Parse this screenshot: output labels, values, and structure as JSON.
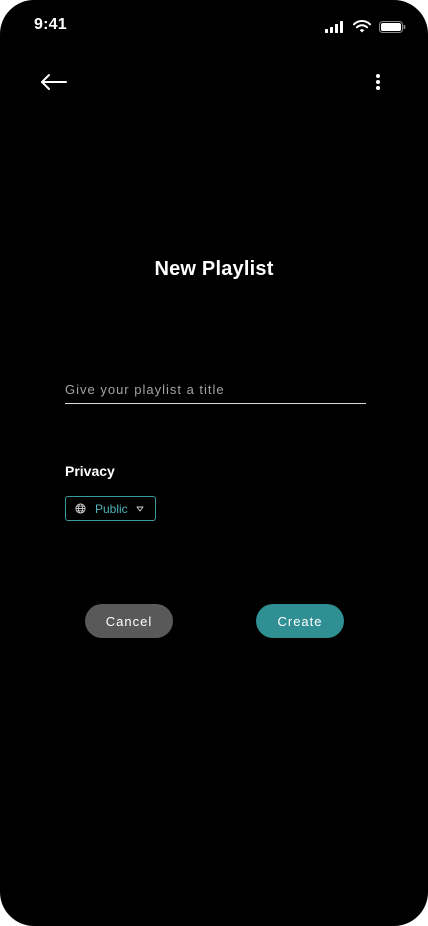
{
  "status_bar": {
    "time": "9:41"
  },
  "header": {
    "back_icon": "arrow-left-icon",
    "more_icon": "more-vertical-icon"
  },
  "page": {
    "title": "New Playlist"
  },
  "title_field": {
    "value": "",
    "placeholder": "Give your playlist a title"
  },
  "privacy": {
    "label": "Privacy",
    "selected": "Public",
    "icon": "globe-icon"
  },
  "actions": {
    "cancel_label": "Cancel",
    "create_label": "Create"
  },
  "colors": {
    "background": "#000000",
    "accent": "#2f8f93",
    "cancel": "#595959"
  }
}
